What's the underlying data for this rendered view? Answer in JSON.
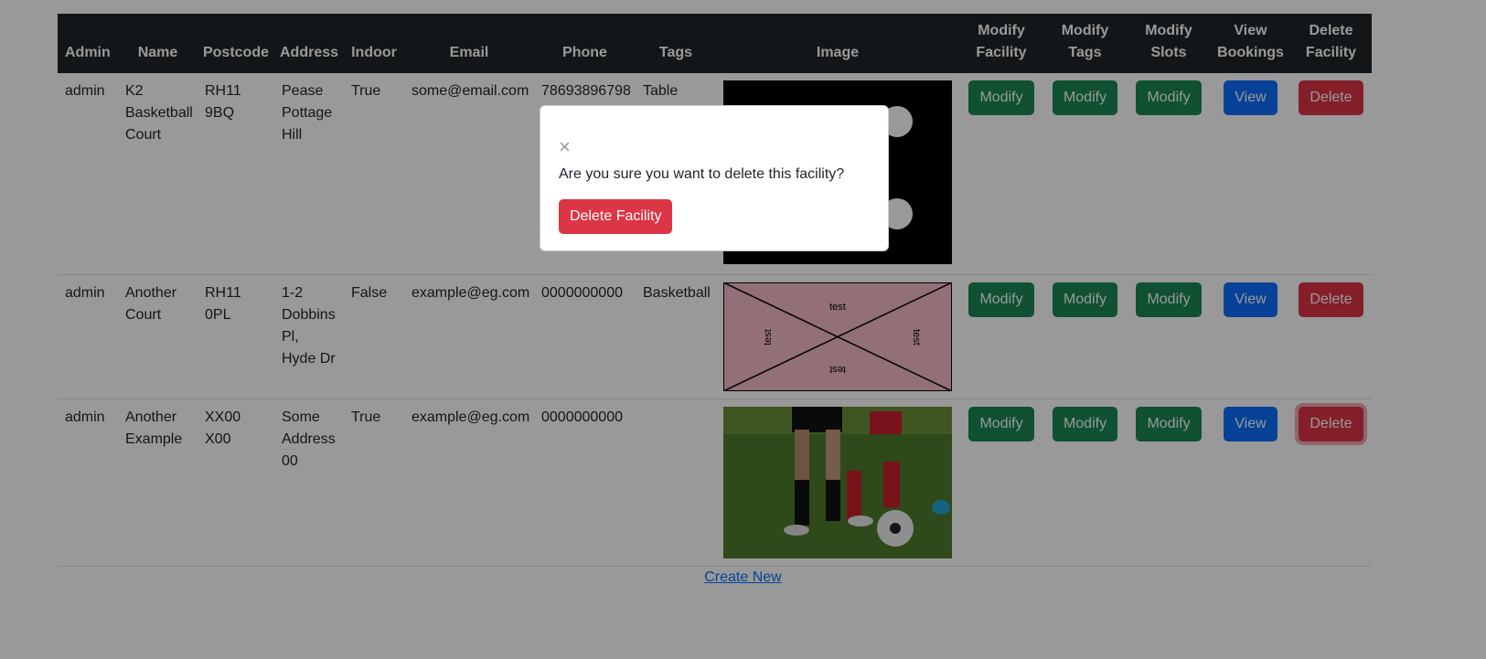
{
  "headers": [
    "Admin",
    "Name",
    "Postcode",
    "Address",
    "Indoor",
    "Email",
    "Phone",
    "Tags",
    "Image",
    "Modify Facility",
    "Modify Tags",
    "Modify Slots",
    "View Bookings",
    "Delete Facility"
  ],
  "rows": [
    {
      "admin": "admin",
      "name": "K2 Basketball Court",
      "postcode": "RH11 9BQ",
      "address": "Pease Pottage Hill",
      "indoor": "True",
      "email": "some@email.com",
      "phone": "78693896798",
      "tags": "Table"
    },
    {
      "admin": "admin",
      "name": "Another Court",
      "postcode": "RH11 0PL",
      "address": "1-2 Dobbins Pl, Hyde Dr",
      "indoor": "False",
      "email": "example@eg.com",
      "phone": "0000000000",
      "tags": "Basketball"
    },
    {
      "admin": "admin",
      "name": "Another Example",
      "postcode": "XX00 X00",
      "address": "Some Address 00",
      "indoor": "True",
      "email": "example@eg.com",
      "phone": "0000000000",
      "tags": ""
    }
  ],
  "buttons": {
    "modify": "Modify",
    "view": "View",
    "delete": "Delete"
  },
  "placeholder_label": "test",
  "create_link": "Create New",
  "modal": {
    "close": "×",
    "message": "Are you sure you want to delete this facility?",
    "confirm": "Delete Facility"
  },
  "colors": {
    "header": "#212529",
    "green": "#198754",
    "blue": "#0d6efd",
    "red": "#dc3545",
    "placeholder_bg": "#f5bac8"
  }
}
